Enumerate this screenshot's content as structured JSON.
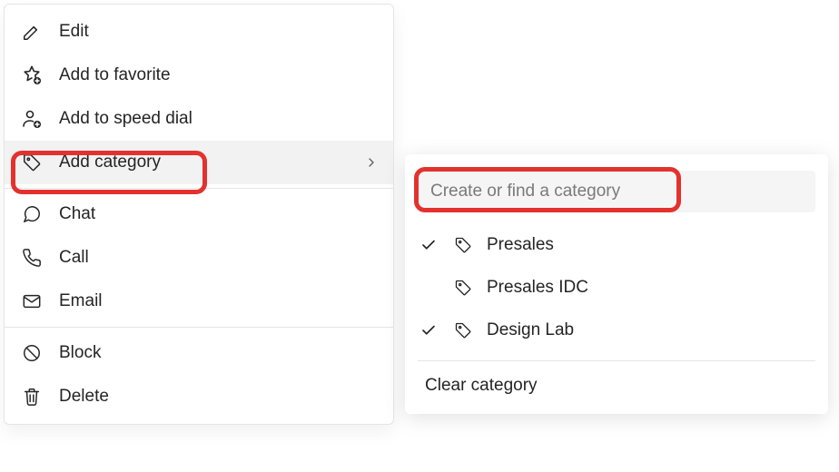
{
  "menu": {
    "edit": "Edit",
    "favorite": "Add to favorite",
    "speed_dial": "Add to speed dial",
    "add_category": "Add category",
    "chat": "Chat",
    "call": "Call",
    "email": "Email",
    "block": "Block",
    "delete": "Delete"
  },
  "submenu": {
    "search_placeholder": "Create or find a category",
    "categories": [
      {
        "label": "Presales",
        "checked": true
      },
      {
        "label": "Presales IDC",
        "checked": false
      },
      {
        "label": "Design Lab",
        "checked": true
      }
    ],
    "clear": "Clear category"
  }
}
